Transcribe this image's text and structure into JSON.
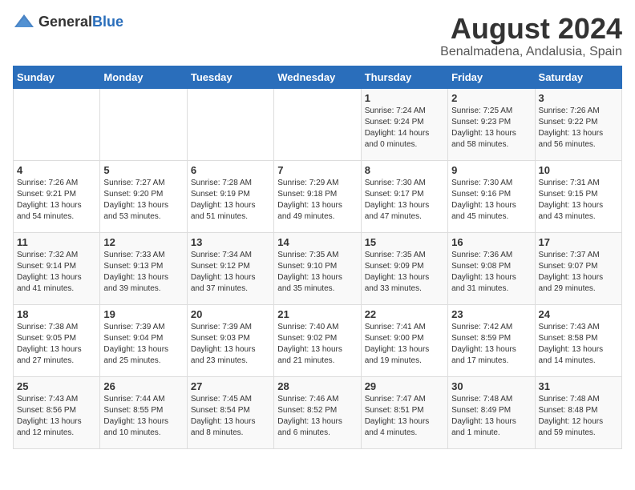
{
  "header": {
    "logo_general": "General",
    "logo_blue": "Blue",
    "month_year": "August 2024",
    "location": "Benalmadena, Andalusia, Spain"
  },
  "days_of_week": [
    "Sunday",
    "Monday",
    "Tuesday",
    "Wednesday",
    "Thursday",
    "Friday",
    "Saturday"
  ],
  "weeks": [
    [
      {
        "day": "",
        "info": ""
      },
      {
        "day": "",
        "info": ""
      },
      {
        "day": "",
        "info": ""
      },
      {
        "day": "",
        "info": ""
      },
      {
        "day": "1",
        "info": "Sunrise: 7:24 AM\nSunset: 9:24 PM\nDaylight: 14 hours\nand 0 minutes."
      },
      {
        "day": "2",
        "info": "Sunrise: 7:25 AM\nSunset: 9:23 PM\nDaylight: 13 hours\nand 58 minutes."
      },
      {
        "day": "3",
        "info": "Sunrise: 7:26 AM\nSunset: 9:22 PM\nDaylight: 13 hours\nand 56 minutes."
      }
    ],
    [
      {
        "day": "4",
        "info": "Sunrise: 7:26 AM\nSunset: 9:21 PM\nDaylight: 13 hours\nand 54 minutes."
      },
      {
        "day": "5",
        "info": "Sunrise: 7:27 AM\nSunset: 9:20 PM\nDaylight: 13 hours\nand 53 minutes."
      },
      {
        "day": "6",
        "info": "Sunrise: 7:28 AM\nSunset: 9:19 PM\nDaylight: 13 hours\nand 51 minutes."
      },
      {
        "day": "7",
        "info": "Sunrise: 7:29 AM\nSunset: 9:18 PM\nDaylight: 13 hours\nand 49 minutes."
      },
      {
        "day": "8",
        "info": "Sunrise: 7:30 AM\nSunset: 9:17 PM\nDaylight: 13 hours\nand 47 minutes."
      },
      {
        "day": "9",
        "info": "Sunrise: 7:30 AM\nSunset: 9:16 PM\nDaylight: 13 hours\nand 45 minutes."
      },
      {
        "day": "10",
        "info": "Sunrise: 7:31 AM\nSunset: 9:15 PM\nDaylight: 13 hours\nand 43 minutes."
      }
    ],
    [
      {
        "day": "11",
        "info": "Sunrise: 7:32 AM\nSunset: 9:14 PM\nDaylight: 13 hours\nand 41 minutes."
      },
      {
        "day": "12",
        "info": "Sunrise: 7:33 AM\nSunset: 9:13 PM\nDaylight: 13 hours\nand 39 minutes."
      },
      {
        "day": "13",
        "info": "Sunrise: 7:34 AM\nSunset: 9:12 PM\nDaylight: 13 hours\nand 37 minutes."
      },
      {
        "day": "14",
        "info": "Sunrise: 7:35 AM\nSunset: 9:10 PM\nDaylight: 13 hours\nand 35 minutes."
      },
      {
        "day": "15",
        "info": "Sunrise: 7:35 AM\nSunset: 9:09 PM\nDaylight: 13 hours\nand 33 minutes."
      },
      {
        "day": "16",
        "info": "Sunrise: 7:36 AM\nSunset: 9:08 PM\nDaylight: 13 hours\nand 31 minutes."
      },
      {
        "day": "17",
        "info": "Sunrise: 7:37 AM\nSunset: 9:07 PM\nDaylight: 13 hours\nand 29 minutes."
      }
    ],
    [
      {
        "day": "18",
        "info": "Sunrise: 7:38 AM\nSunset: 9:05 PM\nDaylight: 13 hours\nand 27 minutes."
      },
      {
        "day": "19",
        "info": "Sunrise: 7:39 AM\nSunset: 9:04 PM\nDaylight: 13 hours\nand 25 minutes."
      },
      {
        "day": "20",
        "info": "Sunrise: 7:39 AM\nSunset: 9:03 PM\nDaylight: 13 hours\nand 23 minutes."
      },
      {
        "day": "21",
        "info": "Sunrise: 7:40 AM\nSunset: 9:02 PM\nDaylight: 13 hours\nand 21 minutes."
      },
      {
        "day": "22",
        "info": "Sunrise: 7:41 AM\nSunset: 9:00 PM\nDaylight: 13 hours\nand 19 minutes."
      },
      {
        "day": "23",
        "info": "Sunrise: 7:42 AM\nSunset: 8:59 PM\nDaylight: 13 hours\nand 17 minutes."
      },
      {
        "day": "24",
        "info": "Sunrise: 7:43 AM\nSunset: 8:58 PM\nDaylight: 13 hours\nand 14 minutes."
      }
    ],
    [
      {
        "day": "25",
        "info": "Sunrise: 7:43 AM\nSunset: 8:56 PM\nDaylight: 13 hours\nand 12 minutes."
      },
      {
        "day": "26",
        "info": "Sunrise: 7:44 AM\nSunset: 8:55 PM\nDaylight: 13 hours\nand 10 minutes."
      },
      {
        "day": "27",
        "info": "Sunrise: 7:45 AM\nSunset: 8:54 PM\nDaylight: 13 hours\nand 8 minutes."
      },
      {
        "day": "28",
        "info": "Sunrise: 7:46 AM\nSunset: 8:52 PM\nDaylight: 13 hours\nand 6 minutes."
      },
      {
        "day": "29",
        "info": "Sunrise: 7:47 AM\nSunset: 8:51 PM\nDaylight: 13 hours\nand 4 minutes."
      },
      {
        "day": "30",
        "info": "Sunrise: 7:48 AM\nSunset: 8:49 PM\nDaylight: 13 hours\nand 1 minute."
      },
      {
        "day": "31",
        "info": "Sunrise: 7:48 AM\nSunset: 8:48 PM\nDaylight: 12 hours\nand 59 minutes."
      }
    ]
  ]
}
